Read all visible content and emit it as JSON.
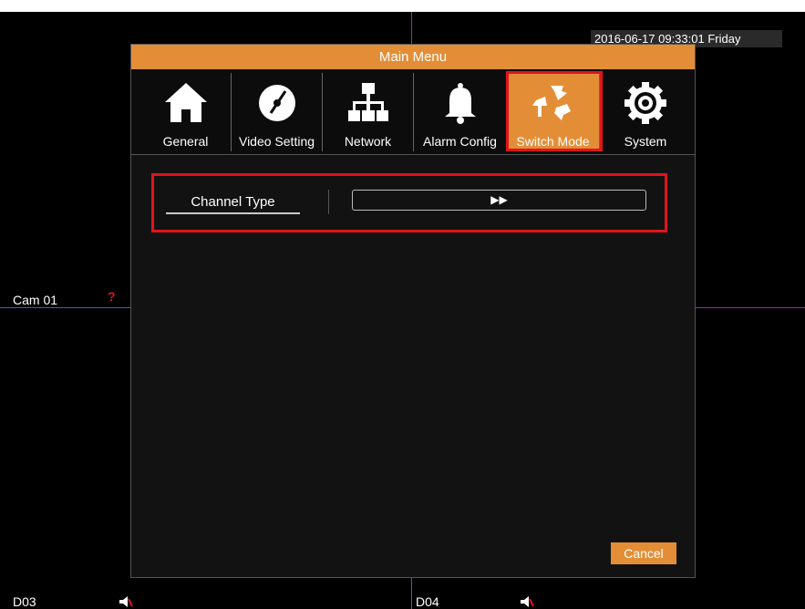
{
  "datetime": "2016-06-17 09:33:01  Friday",
  "cameras": {
    "cam1": "Cam 01",
    "cam1_alert": "?",
    "d03": "D03",
    "d04": "D04"
  },
  "menu": {
    "title": "Main Menu",
    "tabs": [
      {
        "label": "General",
        "icon": "home-icon"
      },
      {
        "label": "Video Setting",
        "icon": "disc-icon"
      },
      {
        "label": "Network",
        "icon": "network-icon"
      },
      {
        "label": "Alarm Config",
        "icon": "bell-icon"
      },
      {
        "label": "Switch Mode",
        "icon": "switch-arrows-icon"
      },
      {
        "label": "System",
        "icon": "gear-icon"
      }
    ],
    "active_tab": "Switch Mode",
    "channel_type": {
      "label": "Channel Type",
      "value": "▶▶"
    },
    "cancel_label": "Cancel"
  },
  "colors": {
    "accent": "#e38e36",
    "highlight": "#e0141c",
    "grid_line": "#a020d0",
    "blue_line": "#3b5bd6"
  }
}
